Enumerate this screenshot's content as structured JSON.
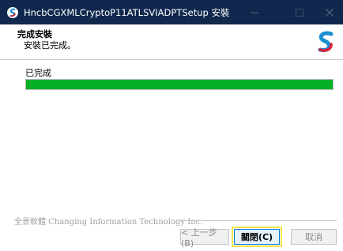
{
  "window": {
    "title": "HncbCGXMLCryptoP11ATLSVIADPTSetup 安裝",
    "title_bg": "#10284d",
    "minimize_icon": "minimize-icon",
    "maximize_icon": "maximize-icon",
    "close_icon": "close-icon"
  },
  "header": {
    "title": "完成安裝",
    "subtitle": "安裝已完成。",
    "logo_icon": "brand-s-logo"
  },
  "progress": {
    "label": "已完成",
    "value": 1.0,
    "fill_color": "#06b025"
  },
  "footer": {
    "brand": "全景軟體 Changing Information Technology Inc."
  },
  "buttons": {
    "back": "< 上一步(B)",
    "close": "關閉(C)",
    "cancel": "取消"
  }
}
